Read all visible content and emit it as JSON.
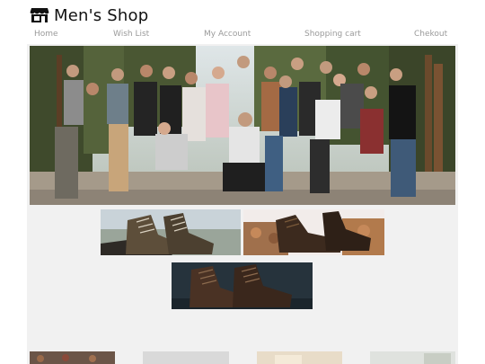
{
  "header": {
    "title": "Men's Shop",
    "logo_icon": "store-icon"
  },
  "nav": {
    "items": [
      {
        "label": "Home"
      },
      {
        "label": "Wish List"
      },
      {
        "label": "My Account"
      },
      {
        "label": "Shopping cart"
      },
      {
        "label": "Chekout"
      }
    ]
  },
  "colors": {
    "page_background": "#f1f1f1",
    "header_background": "#ffffff",
    "nav_text": "#9a9a9a",
    "title_text": "#111111"
  }
}
